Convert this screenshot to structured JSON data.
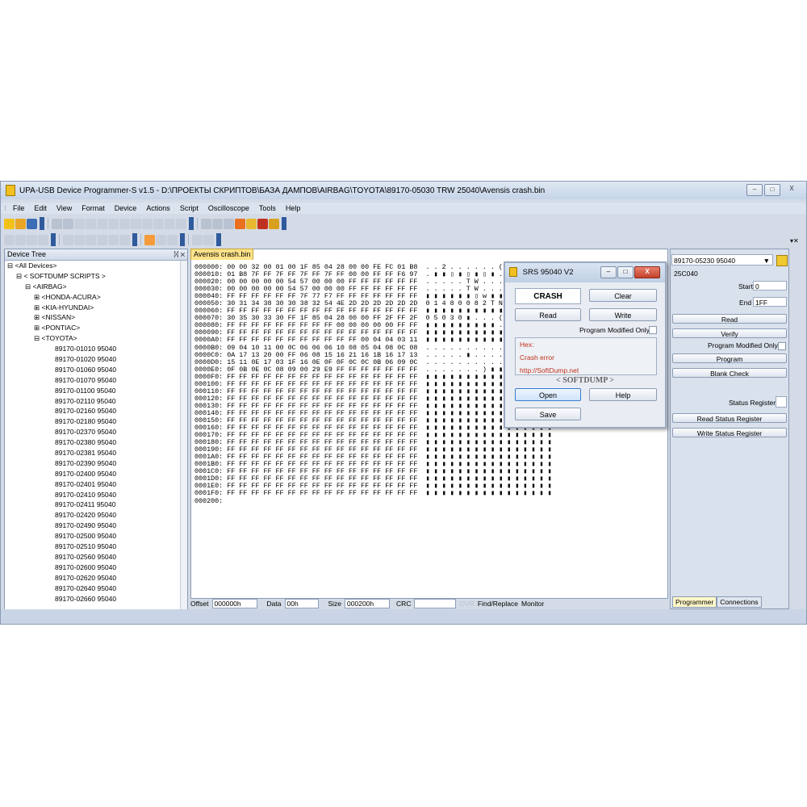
{
  "window": {
    "title": "UPA-USB Device Programmer-S v1.5 - D:\\ПРОЕКТЫ СКРИПТОВ\\БАЗА ДАМПОВ\\AIRBAG\\TOYOTA\\89170-05030 TRW 25040\\Avensis crash.bin",
    "min": "–",
    "max": "□",
    "close": "X"
  },
  "menu": [
    "File",
    "Edit",
    "View",
    "Format",
    "Device",
    "Actions",
    "Script",
    "Oscilloscope",
    "Tools",
    "Help"
  ],
  "tree_panel": {
    "title": "Device Tree",
    "pins": "ᛞ ✕",
    "items": [
      {
        "indent": 0,
        "text": "⊟ <All Devices>"
      },
      {
        "indent": 1,
        "text": "⊟ < SOFTDUMP SCRIPTS >"
      },
      {
        "indent": 2,
        "text": "⊟ <AIRBAG>"
      },
      {
        "indent": 3,
        "text": "⊞ <HONDA-ACURA>"
      },
      {
        "indent": 3,
        "text": "⊞ <KIA-HYUNDAI>"
      },
      {
        "indent": 3,
        "text": "⊞ <NISSAN>"
      },
      {
        "indent": 3,
        "text": "⊞ <PONTIAC>"
      },
      {
        "indent": 3,
        "text": "⊟ <TOYOTA>"
      },
      {
        "indent": 4,
        "text": "89170-01010 95040"
      },
      {
        "indent": 4,
        "text": "89170-01020 95040"
      },
      {
        "indent": 4,
        "text": "89170-01060 95040"
      },
      {
        "indent": 4,
        "text": "89170-01070 95040"
      },
      {
        "indent": 4,
        "text": "89170-01100 95040"
      },
      {
        "indent": 4,
        "text": "89170-02110 95040"
      },
      {
        "indent": 4,
        "text": "89170-02160 95040"
      },
      {
        "indent": 4,
        "text": "89170-02180 95040"
      },
      {
        "indent": 4,
        "text": "89170-02370 95040"
      },
      {
        "indent": 4,
        "text": "89170-02380 95040"
      },
      {
        "indent": 4,
        "text": "89170-02381 95040"
      },
      {
        "indent": 4,
        "text": "89170-02390 95040"
      },
      {
        "indent": 4,
        "text": "89170-02400 95040"
      },
      {
        "indent": 4,
        "text": "89170-02401 95040"
      },
      {
        "indent": 4,
        "text": "89170-02410 95040"
      },
      {
        "indent": 4,
        "text": "89170-02411 95040"
      },
      {
        "indent": 4,
        "text": "89170-02420 95040"
      },
      {
        "indent": 4,
        "text": "89170-02490 95040"
      },
      {
        "indent": 4,
        "text": "89170-02500 95040"
      },
      {
        "indent": 4,
        "text": "89170-02510 95040"
      },
      {
        "indent": 4,
        "text": "89170-02560 95040"
      },
      {
        "indent": 4,
        "text": "89170-02600 95040"
      },
      {
        "indent": 4,
        "text": "89170-02620 95040"
      },
      {
        "indent": 4,
        "text": "89170-02640 95040"
      },
      {
        "indent": 4,
        "text": "89170-02660 95040"
      }
    ]
  },
  "editor": {
    "tab": "Avensis crash.bin",
    "lines": [
      "000000: 00 00 32 00 01 00 1F 85 04 28 00 00 FE FC 01 B8  . . 2 . . . . . . ( . . . ▮ ▮ ▮",
      "000010: 01 B8 7F FF 7F FF 7F FF 7F FF 00 00 FF FF F6 97  . ▮ ▮ ▯ ▮ ▯ ▮ ▯ ▮ . . ▮ ▮ ▮ ▮ ▮",
      "000020: 00 00 00 00 00 54 57 00 00 00 FF FF FF FF FF FF  . . . . . T W . . . ▮ ▮ ▮ ▮ ▮ ▮",
      "000030: 00 00 00 00 00 54 57 00 00 00 FF FF FF FF FF FF  . . . . . T W . . . ▮ ▮ ▮ ▮ ▮ ▮",
      "000040: FF FF FF FF FF FF 7F 77 F7 FF FF FF FF FF FF FF  ▮ ▮ ▮ ▮ ▮ ▮ ▯ w ▮ ▮ ▮ ▮ ▮ ▮ ▮ ▮",
      "000050: 30 31 34 38 30 30 38 32 54 4E 2D 2D 2D 2D 2D 2D  0 1 4 8 0 0 8 2 T N - - - - - -",
      "000060: FF FF FF FF FF FF FF FF FF FF FF FF FF FF FF FF  ▮ ▮ ▮ ▮ ▮ ▮ ▮ ▮ ▮ ▮ ▮ ▮ ▮ ▮ ▮ ▮",
      "000070: 30 35 30 33 30 FF 1F 85 04 28 00 00 FF 2F FF 2F  0 5 0 3 0 ▮ . . . ( . . ▮ / ▮ /",
      "000080: FF FF FF FF FF FF FF FF FF 00 00 00 00 00 FF FF  ▮ ▮ ▮ ▮ ▮ ▮ ▮ ▮ ▮ . . . . . ▮ ▮",
      "000090: FF FF FF FF FF FF FF FF FF FF FF FF FF FF FF FF  ▮ ▮ ▮ ▮ ▮ ▮ ▮ ▮ ▮ ▮ ▮ ▮ ▮ ▮ ▮ ▮",
      "0000A0: FF FF FF FF FF FF FF FF FF FF FF 00 04 04 03 11  ▮ ▮ ▮ ▮ ▮ ▮ ▮ ▮ ▮ ▮ ▮ . . . . .",
      "0000B0: 09 04 10 11 00 0C 06 06 06 10 08 05 04 08 0C 08  . . . . . . . . . . . . . . . .",
      "0000C0: 0A 17 13 20 00 FF 06 08 15 16 21 16 1B 16 17 13  . . . . . ▮ . . . . ! . . . . .",
      "0000D0: 15 11 0E 17 03 1F 16 0E 0F 0F 0C 0C 0B 06 09 0C  . . . . . . . . . . . . . . . .",
      "0000E0: 0F 0B 0E 0C 08 09 00 29 E9 FF FF FF FF FF FF FF  . . . . . . . ) ▮ ▮ ▮ ▮ ▮ ▮ ▮ ▮",
      "0000F0: FF FF FF FF FF FF FF FF FF FF FF FF FF FF FF FF  ▮ ▮ ▮ ▮ ▮ ▮ ▮ ▮ ▮ ▮ ▮ ▮ ▮ ▮ ▮ ▮",
      "000100: FF FF FF FF FF FF FF FF FF FF FF FF FF FF FF FF  ▮ ▮ ▮ ▮ ▮ ▮ ▮ ▮ ▮ ▮ ▮ ▮ ▮ ▮ ▮ ▮",
      "000110: FF FF FF FF FF FF FF FF FF FF FF FF FF FF FF FF  ▮ ▮ ▮ ▮ ▮ ▮ ▮ ▮ ▮ ▮ ▮ ▮ ▮ ▮ ▮ ▮",
      "000120: FF FF FF FF FF FF FF FF FF FF FF FF FF FF FF FF  ▮ ▮ ▮ ▮ ▮ ▮ ▮ ▮ ▮ ▮ ▮ ▮ ▮ ▮ ▮ ▮",
      "000130: FF FF FF FF FF FF FF FF FF FF FF FF FF FF FF FF  ▮ ▮ ▮ ▮ ▮ ▮ ▮ ▮ ▮ ▮ ▮ ▮ ▮ ▮ ▮ ▮",
      "000140: FF FF FF FF FF FF FF FF FF FF FF FF FF FF FF FF  ▮ ▮ ▮ ▮ ▮ ▮ ▮ ▮ ▮ ▮ ▮ ▮ ▮ ▮ ▮ ▮",
      "000150: FF FF FF FF FF FF FF FF FF FF FF FF FF FF FF FF  ▮ ▮ ▮ ▮ ▮ ▮ ▮ ▮ ▮ ▮ ▮ ▮ ▮ ▮ ▮ ▮",
      "000160: FF FF FF FF FF FF FF FF FF FF FF FF FF FF FF FF  ▮ ▮ ▮ ▮ ▮ ▮ ▮ ▮ ▮ ▮ ▮ ▮ ▮ ▮ ▮ ▮",
      "000170: FF FF FF FF FF FF FF FF FF FF FF FF FF FF FF FF  ▮ ▮ ▮ ▮ ▮ ▮ ▮ ▮ ▮ ▮ ▮ ▮ ▮ ▮ ▮ ▮",
      "000180: FF FF FF FF FF FF FF FF FF FF FF FF FF FF FF FF  ▮ ▮ ▮ ▮ ▮ ▮ ▮ ▮ ▮ ▮ ▮ ▮ ▮ ▮ ▮ ▮",
      "000190: FF FF FF FF FF FF FF FF FF FF FF FF FF FF FF FF  ▮ ▮ ▮ ▮ ▮ ▮ ▮ ▮ ▮ ▮ ▮ ▮ ▮ ▮ ▮ ▮",
      "0001A0: FF FF FF FF FF FF FF FF FF FF FF FF FF FF FF FF  ▮ ▮ ▮ ▮ ▮ ▮ ▮ ▮ ▮ ▮ ▮ ▮ ▮ ▮ ▮ ▮",
      "0001B0: FF FF FF FF FF FF FF FF FF FF FF FF FF FF FF FF  ▮ ▮ ▮ ▮ ▮ ▮ ▮ ▮ ▮ ▮ ▮ ▮ ▮ ▮ ▮ ▮",
      "0001C0: FF FF FF FF FF FF FF FF FF FF FF FF FF FF FF FF  ▮ ▮ ▮ ▮ ▮ ▮ ▮ ▮ ▮ ▮ ▮ ▮ ▮ ▮ ▮ ▮",
      "0001D0: FF FF FF FF FF FF FF FF FF FF FF FF FF FF FF FF  ▮ ▮ ▮ ▮ ▮ ▮ ▮ ▮ ▮ ▮ ▮ ▮ ▮ ▮ ▮ ▮",
      "0001E0: FF FF FF FF FF FF FF FF FF FF FF FF FF FF FF FF  ▮ ▮ ▮ ▮ ▮ ▮ ▮ ▮ ▮ ▮ ▮ ▮ ▮ ▮ ▮ ▮",
      "0001F0: FF FF FF FF FF FF FF FF FF FF FF FF FF FF FF FF  ▮ ▮ ▮ ▮ ▮ ▮ ▮ ▮ ▮ ▮ ▮ ▮ ▮ ▮ ▮ ▮",
      "000200:"
    ]
  },
  "status": {
    "offset_label": "Offset",
    "offset_value": "000000h",
    "data_label": "Data",
    "data_value": "00h",
    "size_label": "Size",
    "size_value": "000200h",
    "crc_label": "CRC",
    "crc_value": "",
    "ovr_label": "OVR",
    "find_label": "Find/Replace",
    "monitor_label": "Monitor"
  },
  "programmer": {
    "device_select": "89170-05230 95040",
    "chip_label": "25C040",
    "start_label": "Start",
    "start_value": "0",
    "end_label": "End",
    "end_value": "1FF",
    "read": "Read",
    "verify": "Verify",
    "program_modified_only": "Program Modified Only",
    "program": "Program",
    "blank_check": "Blank Check",
    "status_register": "Status Register",
    "read_status_register": "Read Status Register",
    "write_status_register": "Write Status Register",
    "tabs": [
      "Programmer",
      "Connections"
    ]
  },
  "dialog": {
    "title": "SRS 95040 V2",
    "crash": "CRASH",
    "clear": "Clear",
    "read": "Read",
    "write": "Write",
    "program_modified_only": "Program Modified Only",
    "hex_label": "Hex:",
    "error": "Crash error",
    "url": "http://SoftDump.net",
    "brand": "< SOFTDUMP >",
    "open": "Open",
    "help": "Help",
    "save": "Save"
  },
  "colors": {
    "accent": "#2f5a9c",
    "tab_active": "#ffe38a",
    "error_text": "#c0301c"
  }
}
